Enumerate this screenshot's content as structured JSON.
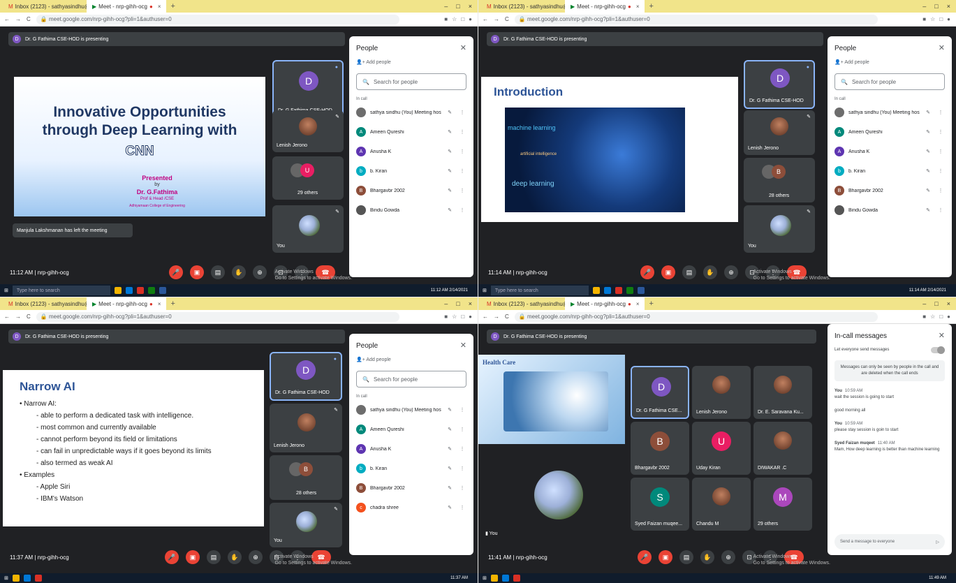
{
  "colors": {
    "accent": "#8ab4f8",
    "danger": "#ea4335",
    "meet_bg": "#202124",
    "tile_bg": "#3c4043",
    "tabbar": "#f1e48a"
  },
  "browser": {
    "tab1": "Inbox (2123) - sathyasindhu@",
    "tab2": "Meet - nrp-gihh-ocg",
    "url_a": "meet.google.com/nrp-gihh-ocg?pli=1&authuser=0",
    "url_b": "meet.google.com/nrp-gihh-ocg?pli=1&authuser=0"
  },
  "presenting": "Dr. G Fathima CSE-HOD is presenting",
  "q1": {
    "slide": {
      "title": "Innovative Opportunities through Deep Learning with",
      "cnn": "CNN",
      "presented": "Presented",
      "by": "by",
      "name": "Dr. G.Fathima",
      "role": "Prof & Head /CSE",
      "college": "Adhiyamaan College of Engineering"
    },
    "toast": "Manjula Lakshmanan has left the meeting",
    "tiles": {
      "host": "Dr. G Fathima CSE-HOD",
      "lenish": "Lenish Jerono",
      "others": "29 others",
      "you": "You"
    },
    "time": "11:12 AM",
    "clock": "11:12 AM 2/14/2021"
  },
  "q2": {
    "slide": {
      "title": "Introduction",
      "ml": "machine learning",
      "ai": "artificial intelligence",
      "dl": "deep learning"
    },
    "tiles": {
      "host": "Dr. G Fathima CSE-HOD",
      "lenish": "Lenish Jerono",
      "others": "28 others",
      "you": "You"
    },
    "time": "11:14 AM",
    "clock": "11:14 AM 2/14/2021"
  },
  "q3": {
    "slide": {
      "title": "Narrow AI",
      "lines": [
        "• Narrow AI:",
        "- able to perform a dedicated task with intelligence.",
        "- most common and currently available",
        "- cannot perform beyond its field or limitations",
        "- can fail in unpredictable ways if it goes beyond its limits",
        "- also termed as weak AI",
        "• Examples",
        "- Apple Siri",
        "- IBM's Watson"
      ]
    },
    "tiles": {
      "host": "Dr. G Fathima CSE-HOD",
      "lenish": "Lenish Jerono",
      "others": "28 others",
      "you": "You"
    },
    "time": "11:37 AM",
    "clock": "11:37 AM"
  },
  "q4": {
    "slide": {
      "title": "Health Care"
    },
    "tiles": [
      {
        "name": "Dr. G Fathima CSE...",
        "letter": "D",
        "color": "#7e57c2"
      },
      {
        "name": "Lenish Jerono",
        "letter": "",
        "color": ""
      },
      {
        "name": "Dr. E. Saravana Ku...",
        "letter": "",
        "color": ""
      },
      {
        "name": "Bhargavbr 2002",
        "letter": "B",
        "color": "#8d4e3a"
      },
      {
        "name": "Uday Kiran",
        "letter": "U",
        "color": "#e91e63"
      },
      {
        "name": "DIWAKAR .C",
        "letter": "",
        "color": ""
      },
      {
        "name": "Syed Faizan muqee...",
        "letter": "S",
        "color": "#00897b"
      },
      {
        "name": "Chandu M",
        "letter": "",
        "color": ""
      },
      {
        "name": "29 others",
        "letter": "M",
        "color": "#ab47bc"
      }
    ],
    "you": "You",
    "time": "11:41 AM",
    "clock": "11:49 AM",
    "chat": {
      "title": "In-call messages",
      "toggle": "Let everyone send messages",
      "note": "Messages can only be seen by people in the call and are deleted when the call ends",
      "messages": [
        {
          "who": "You",
          "t": "10:59 AM",
          "text": "wait the session is going to start"
        },
        {
          "who": "",
          "t": "",
          "text": "good morning all"
        },
        {
          "who": "You",
          "t": "10:59 AM",
          "text": "please stay session is goin to start"
        },
        {
          "who": "Syed Faizan muqeet",
          "t": "11:40 AM",
          "text": "Mam, How deep learning is better than machine learning"
        }
      ],
      "input": "Send a message to everyone"
    }
  },
  "people": {
    "title": "People",
    "add": "Add people",
    "search": "Search for people",
    "incall": "In call",
    "list_a": [
      {
        "name": "sathya sindhu (You) Meeting host",
        "letter": "",
        "color": "#6d6d6d"
      },
      {
        "name": "Ameen Qureshi",
        "letter": "A",
        "color": "#00897b"
      },
      {
        "name": "Anusha K",
        "letter": "A",
        "color": "#5e35b1"
      },
      {
        "name": "b. Kiran",
        "letter": "b",
        "color": "#00acc1"
      },
      {
        "name": "Bhargavbr 2002",
        "letter": "B",
        "color": "#8d4e3a"
      },
      {
        "name": "Bindu Gowda",
        "letter": "",
        "color": "#555"
      }
    ],
    "list_b": [
      {
        "name": "sathya sindhu (You) Meeting host",
        "letter": "",
        "color": "#6d6d6d"
      },
      {
        "name": "Ameen Qureshi",
        "letter": "A",
        "color": "#00897b"
      },
      {
        "name": "Anusha K",
        "letter": "A",
        "color": "#5e35b1"
      },
      {
        "name": "b. Kiran",
        "letter": "b",
        "color": "#00acc1"
      },
      {
        "name": "Bhargavbr 2002",
        "letter": "B",
        "color": "#8d4e3a"
      },
      {
        "name": "chadra shree",
        "letter": "c",
        "color": "#f4511e"
      }
    ]
  },
  "meeting_code": "nrp-gihh-ocg",
  "activate": {
    "l1": "Activate Windows",
    "l2": "Go to Settings to activate Windows."
  },
  "taskbar_search": "Type here to search"
}
